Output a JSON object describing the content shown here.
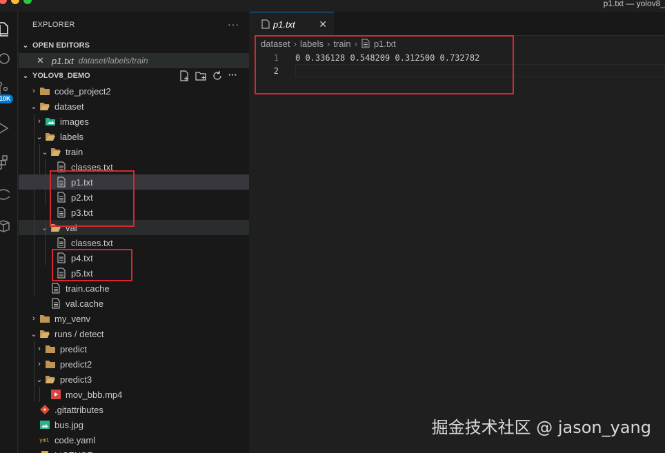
{
  "window": {
    "title": "p1.txt — yolov8_"
  },
  "activity_bar": {
    "badge": "10K"
  },
  "explorer": {
    "title": "EXPLORER",
    "more": "···",
    "open_editors": {
      "label": "OPEN EDITORS",
      "items": [
        {
          "name": "p1.txt",
          "path": "dataset/labels/train"
        }
      ]
    },
    "project": {
      "label": "YOLOV8_DEMO"
    },
    "tree": [
      {
        "label": "code_project2",
        "type": "folder",
        "depth": 0,
        "expanded": false
      },
      {
        "label": "dataset",
        "type": "folder",
        "depth": 0,
        "expanded": true
      },
      {
        "label": "images",
        "type": "folder-images",
        "depth": 1,
        "expanded": false
      },
      {
        "label": "labels",
        "type": "folder",
        "depth": 1,
        "expanded": true
      },
      {
        "label": "train",
        "type": "folder",
        "depth": 2,
        "expanded": true
      },
      {
        "label": "classes.txt",
        "type": "file",
        "depth": 3
      },
      {
        "label": "p1.txt",
        "type": "file",
        "depth": 3,
        "selected": true
      },
      {
        "label": "p2.txt",
        "type": "file",
        "depth": 3
      },
      {
        "label": "p3.txt",
        "type": "file",
        "depth": 3
      },
      {
        "label": "val",
        "type": "folder",
        "depth": 2,
        "expanded": true,
        "hover": true
      },
      {
        "label": "classes.txt",
        "type": "file",
        "depth": 3
      },
      {
        "label": "p4.txt",
        "type": "file",
        "depth": 3
      },
      {
        "label": "p5.txt",
        "type": "file",
        "depth": 3
      },
      {
        "label": "train.cache",
        "type": "file",
        "depth": 2
      },
      {
        "label": "val.cache",
        "type": "file",
        "depth": 2
      },
      {
        "label": "my_venv",
        "type": "folder",
        "depth": 0,
        "expanded": false
      },
      {
        "label": "runs / detect",
        "type": "folder",
        "depth": 0,
        "expanded": true
      },
      {
        "label": "predict",
        "type": "folder",
        "depth": 1,
        "expanded": false
      },
      {
        "label": "predict2",
        "type": "folder",
        "depth": 1,
        "expanded": false
      },
      {
        "label": "predict3",
        "type": "folder",
        "depth": 1,
        "expanded": true
      },
      {
        "label": "mov_bbb.mp4",
        "type": "video",
        "depth": 2
      },
      {
        "label": ".gitattributes",
        "type": "git",
        "depth": 0
      },
      {
        "label": "bus.jpg",
        "type": "image",
        "depth": 0
      },
      {
        "label": "code.yaml",
        "type": "yaml",
        "depth": 0
      },
      {
        "label": "LICENSE",
        "type": "license",
        "depth": 0
      }
    ]
  },
  "editor": {
    "tab": {
      "name": "p1.txt",
      "close": "✕"
    },
    "breadcrumb": [
      "dataset",
      "labels",
      "train",
      "p1.txt"
    ],
    "lines": [
      {
        "number": "1",
        "text": "0 0.336128 0.548209 0.312500 0.732782"
      },
      {
        "number": "2",
        "text": ""
      }
    ]
  },
  "watermark": "掘金技术社区 @ jason_yang",
  "colors": {
    "highlight_box": "#d8282e",
    "accent": "#0078d4",
    "folder": "#c09553"
  }
}
